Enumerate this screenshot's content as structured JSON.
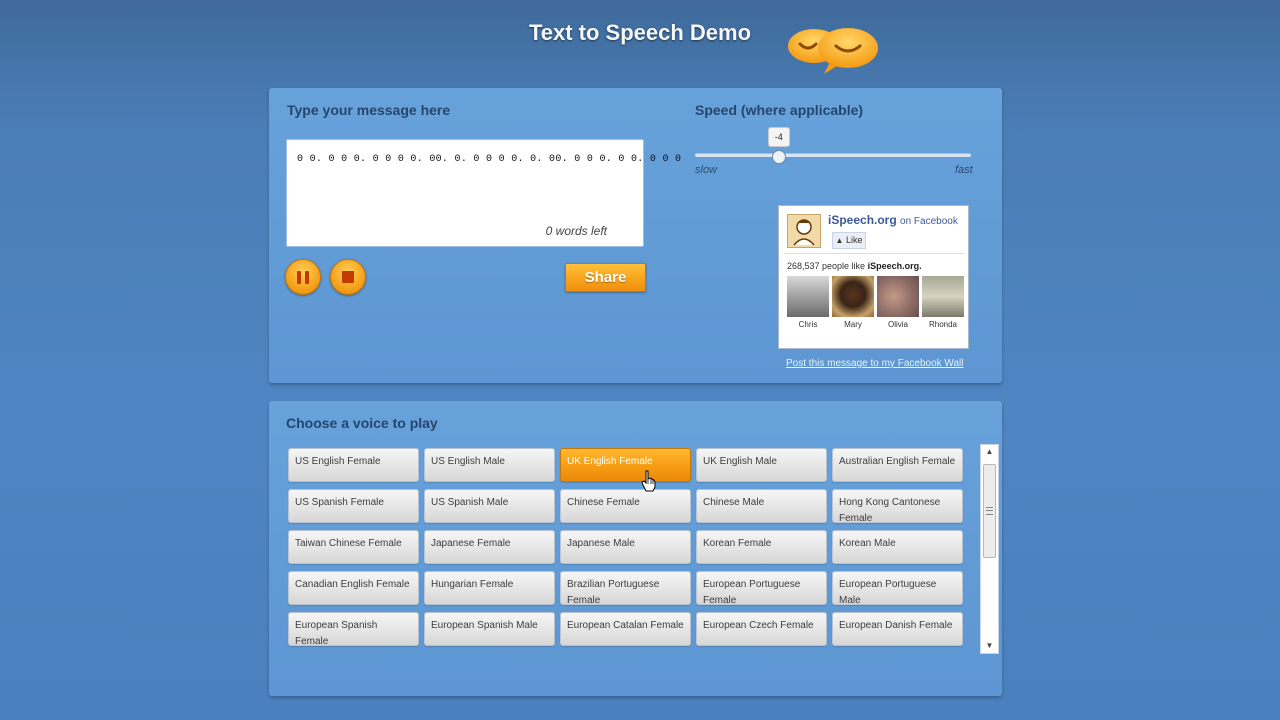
{
  "page": {
    "title": "Text to Speech Demo"
  },
  "message": {
    "heading": "Type your message here",
    "text": "0 0. 0 0 0. 0 0 0 0. 00. 0. 0 0 0 0. 0. 00. 0 0 0. 0 0. 0 0 0",
    "words_left": "0 words left"
  },
  "controls": {
    "pause_icon": "pause-icon",
    "stop_icon": "stop-icon",
    "share_label": "Share"
  },
  "speed": {
    "heading": "Speed (where applicable)",
    "value": "-4",
    "min": -10,
    "max": 10,
    "slow_label": "slow",
    "fast_label": "fast"
  },
  "facebook": {
    "page_name": "iSpeech.org",
    "on_label": "on Facebook",
    "like_label": "Like",
    "count_text": "268,537 people like",
    "count_name": "iSpeech.org.",
    "fans": [
      "Chris",
      "Mary",
      "Olivia",
      "Rhonda"
    ],
    "post_link": "Post this message to my Facebook Wall"
  },
  "voices": {
    "heading": "Choose a voice to play",
    "selected": "UK English Female",
    "items": [
      "US English Female",
      "US English Male",
      "UK English Female",
      "UK English Male",
      "Australian English Female",
      "US Spanish Female",
      "US Spanish Male",
      "Chinese Female",
      "Chinese Male",
      "Hong Kong Cantonese Female",
      "Taiwan Chinese Female",
      "Japanese Female",
      "Japanese Male",
      "Korean Female",
      "Korean Male",
      "Canadian English Female",
      "Hungarian Female",
      "Brazilian Portuguese Female",
      "European Portuguese Female",
      "European Portuguese Male",
      "European Spanish Female",
      "European Spanish Male",
      "European Catalan Female",
      "European Czech Female",
      "European Danish Female"
    ]
  },
  "colors": {
    "accent": "#f5a21a",
    "panel": "#67a2db",
    "heading": "#24466e"
  }
}
